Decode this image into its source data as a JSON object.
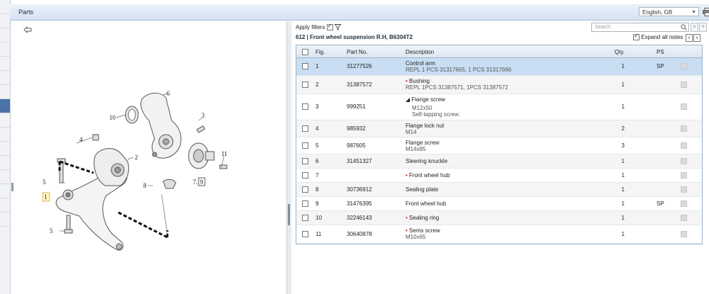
{
  "header": {
    "title": "Parts"
  },
  "language": {
    "selected": "English, GB"
  },
  "filters": {
    "apply_label": "Apply filters",
    "apply_checked": true
  },
  "search": {
    "placeholder": "Search"
  },
  "breadcrumb": "612  |  Front wheel suspension   R.H, B6304T2",
  "expand_all": {
    "label": "Expand all notes",
    "checked": true
  },
  "table": {
    "columns": {
      "fig": "Fig.",
      "part": "Part No.",
      "desc": "Description",
      "qty": "Qty.",
      "ps": "PS"
    },
    "rows": [
      {
        "fig": "1",
        "part": "31277526",
        "desc": "Control arm",
        "sub": "REPL 1 PCS 31317665, 1 PCS 31317666",
        "qty": "1",
        "ps": "SP"
      },
      {
        "fig": "2",
        "part": "31387572",
        "desc": "Bushing",
        "sub": "REPL 1PCS 31387571, 1PCS 31387572",
        "qty": "1",
        "ps": ""
      },
      {
        "fig": "3",
        "part": "999251",
        "desc": "Flange screw",
        "sub": "M12x50",
        "sub2": "Self-tapping screw.",
        "qty": "1",
        "ps": ""
      },
      {
        "fig": "4",
        "part": "985932",
        "desc": "Flange lock nut",
        "sub": "M14",
        "qty": "2",
        "ps": ""
      },
      {
        "fig": "5",
        "part": "987605",
        "desc": "Flange screw",
        "sub": "M14x85",
        "qty": "3",
        "ps": ""
      },
      {
        "fig": "6",
        "part": "31451327",
        "desc": "Steering knuckle",
        "sub": "",
        "qty": "1",
        "ps": ""
      },
      {
        "fig": "7",
        "part": "",
        "desc": "Front wheel hub",
        "sub": "",
        "qty": "1",
        "ps": ""
      },
      {
        "fig": "8",
        "part": "30736912",
        "desc": "Sealing plate",
        "sub": "",
        "qty": "1",
        "ps": ""
      },
      {
        "fig": "9",
        "part": "31476395",
        "desc": "Front wheel hub",
        "sub": "",
        "qty": "1",
        "ps": "SP"
      },
      {
        "fig": "10",
        "part": "32246143",
        "desc": "Sealing ring",
        "sub": "",
        "qty": "1",
        "ps": ""
      },
      {
        "fig": "11",
        "part": "30640878",
        "desc": "Sems screw",
        "sub": "M10x65",
        "qty": "1",
        "ps": ""
      }
    ]
  },
  "diagram_labels": {
    "l1": "1",
    "l2": "2",
    "l3": "3",
    "l4": "4",
    "l5a": "5",
    "l5b": "5",
    "l6": "6",
    "l7": "7.",
    "l8": "8",
    "l9": "9",
    "l10": "10",
    "l11": "11"
  }
}
